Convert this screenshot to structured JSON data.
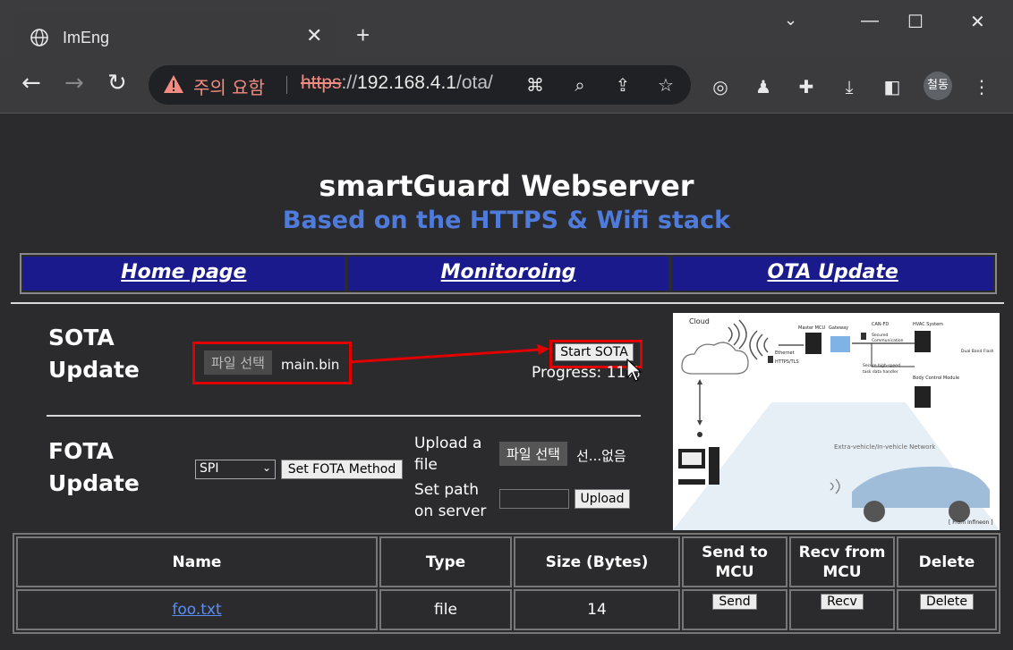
{
  "browser": {
    "tab_title": "ImEng",
    "new_tab": "+",
    "window": {
      "minimize": "—",
      "maximize": "☐",
      "close": "✕"
    },
    "security_warning": "주의 요함",
    "url_scheme": "https",
    "url_sep": "://",
    "url_host": "192.168.4.1",
    "url_path": "/ota/",
    "profile_label": "철동"
  },
  "page": {
    "title": "smartGuard Webserver",
    "subtitle": "Based on the HTTPS & Wifi stack",
    "nav": [
      "Home page",
      "Monitoroing",
      "OTA Update"
    ],
    "sota": {
      "title_line1": "SOTA",
      "title_line2": "Update",
      "file_button": "파일 선택",
      "file_name": "main.bin",
      "start_button": "Start SOTA",
      "progress": "Progress: 11%"
    },
    "fota": {
      "title_line1": "FOTA",
      "title_line2": "Update",
      "method_value": "SPI",
      "set_method_button": "Set FOTA Method",
      "upload_label_1": "Upload a",
      "upload_label_2": "file",
      "file_button": "파일 선택",
      "no_file": "선...없음",
      "path_label_1": "Set path",
      "path_label_2": "on server",
      "upload_button": "Upload"
    },
    "diagram": {
      "cloud": "Cloud",
      "ethernet": "Ethernet",
      "https": "HTTPS/TLS",
      "master_mcu": "Master MCU",
      "gateway": "Gateway",
      "can_fd": "CAN-FD",
      "secured": "Secured",
      "communication": "Communication",
      "hvac": "HVAC System",
      "body_control": "Body Control Module",
      "secure_high_speed": "Secure high-speed",
      "task_handler": "task data handler",
      "dual_band": "Dual Band Flash",
      "network_label": "Extra-vehicle/In-vehicle Network",
      "source": "[ From Infineon ]"
    },
    "table": {
      "headers": [
        "Name",
        "Type",
        "Size (Bytes)",
        "Send to MCU",
        "Recv from MCU",
        "Delete"
      ],
      "rows": [
        {
          "name": "foo.txt",
          "type": "file",
          "size": "14",
          "send": "Send",
          "recv": "Recv",
          "delete": "Delete"
        }
      ]
    }
  }
}
